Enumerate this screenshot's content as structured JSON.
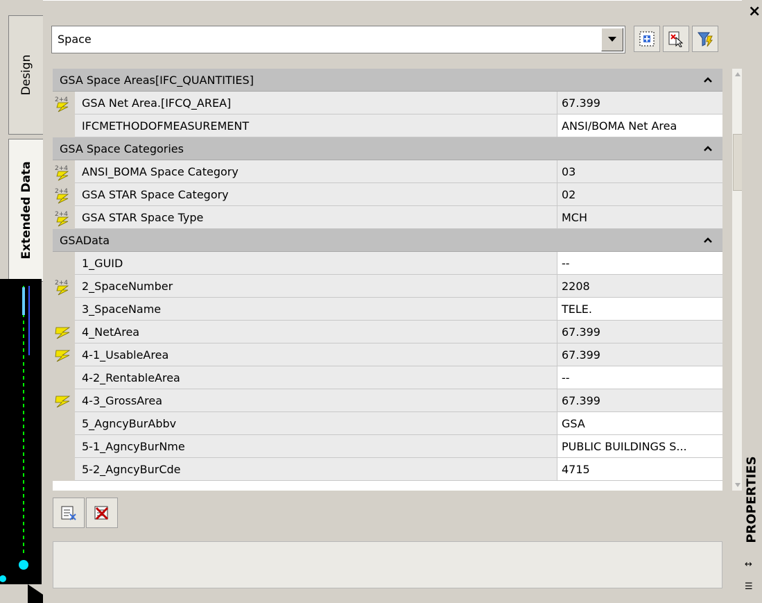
{
  "side_tabs": [
    {
      "label": "Design"
    },
    {
      "label": "Extended Data"
    }
  ],
  "style_select": {
    "value": "Space"
  },
  "toolbar_icons": [
    "select-objects-icon",
    "quick-select-icon",
    "filter-icon"
  ],
  "categories": [
    {
      "label": "GSA Space Areas[IFC_QUANTITIES]",
      "rows": [
        {
          "name": "GSA Net Area.[IFCQ_AREA]",
          "value": "67.399",
          "icon": "formula-lightning-icon",
          "editable": false
        },
        {
          "name": "IFCMETHODOFMEASUREMENT",
          "value": "ANSI/BOMA Net Area",
          "icon": "",
          "editable": true
        }
      ]
    },
    {
      "label": "GSA Space Categories",
      "rows": [
        {
          "name": "ANSI_BOMA Space Category",
          "value": "03",
          "icon": "formula-lightning-icon",
          "editable": false
        },
        {
          "name": "GSA STAR Space Category",
          "value": "02",
          "icon": "formula-lightning-icon",
          "editable": false
        },
        {
          "name": "GSA STAR Space Type",
          "value": "MCH",
          "icon": "formula-lightning-icon",
          "editable": false
        }
      ]
    },
    {
      "label": "GSAData",
      "rows": [
        {
          "name": "1_GUID",
          "value": "--",
          "icon": "",
          "editable": true
        },
        {
          "name": "2_SpaceNumber",
          "value": "2208",
          "icon": "formula-lightning-icon",
          "editable": false
        },
        {
          "name": "3_SpaceName",
          "value": "TELE.",
          "icon": "",
          "editable": true
        },
        {
          "name": "4_NetArea",
          "value": "67.399",
          "icon": "lightning-icon",
          "editable": false
        },
        {
          "name": "4-1_UsableArea",
          "value": "67.399",
          "icon": "lightning-icon",
          "editable": false
        },
        {
          "name": "4-2_RentableArea",
          "value": "--",
          "icon": "",
          "editable": true
        },
        {
          "name": "4-3_GrossArea",
          "value": "67.399",
          "icon": "lightning-icon",
          "editable": false
        },
        {
          "name": "5_AgncyBurAbbv",
          "value": "GSA",
          "icon": "",
          "editable": true
        },
        {
          "name": "5-1_AgncyBurNme",
          "value": "PUBLIC BUILDINGS S...",
          "icon": "",
          "editable": true
        },
        {
          "name": "5-2_AgncyBurCde",
          "value": "4715",
          "icon": "",
          "editable": true
        }
      ]
    }
  ],
  "bottom_buttons": [
    "edit-properties-icon",
    "delete-properties-icon"
  ],
  "palette_title": "PROPERTIES",
  "colors": {
    "category_bg": "#c0c0c0",
    "panel_bg": "#d4d0c8",
    "readonly_bg": "#ebebeb",
    "editable_bg": "#ffffff"
  }
}
